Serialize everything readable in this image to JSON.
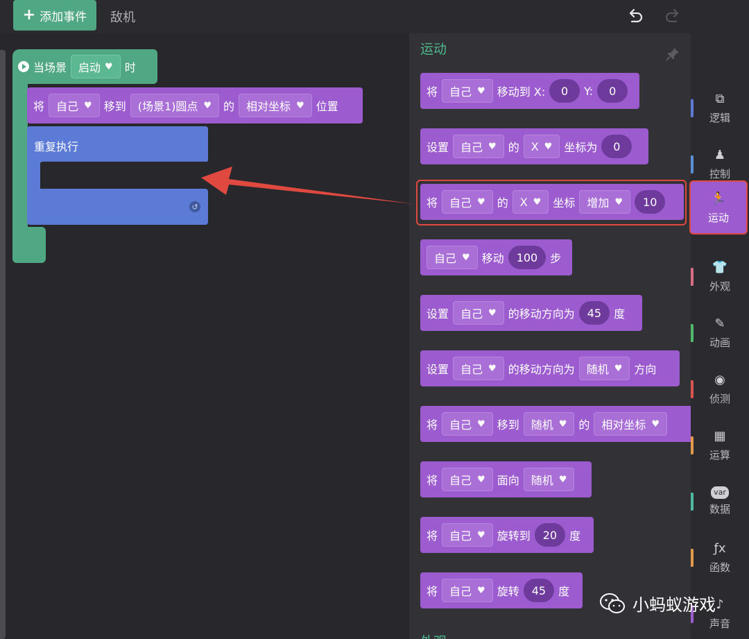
{
  "topbar": {
    "add_event_label": "添加事件",
    "current_tab": "敌机"
  },
  "workspace": {
    "hat": {
      "prefix": "当场景",
      "dropdown": "启动",
      "suffix": "时"
    },
    "move_block": {
      "verb": "将",
      "target": "自己",
      "action": "移到",
      "destination": "(场景1)圆点",
      "of": "的",
      "coord": "相对坐标",
      "suffix": "位置"
    },
    "repeat_label": "重复执行"
  },
  "palette": {
    "section_title": "运动",
    "next_section_title": "外观",
    "blocks": [
      {
        "parts": [
          {
            "t": "text",
            "v": "将"
          },
          {
            "t": "dd",
            "v": "自己"
          },
          {
            "t": "text",
            "v": "移动到 X:"
          },
          {
            "t": "pill",
            "v": "0"
          },
          {
            "t": "text",
            "v": "Y:"
          },
          {
            "t": "pill",
            "v": "0"
          }
        ]
      },
      {
        "parts": [
          {
            "t": "text",
            "v": "设置"
          },
          {
            "t": "dd",
            "v": "自己"
          },
          {
            "t": "text",
            "v": "的"
          },
          {
            "t": "dd",
            "v": "X"
          },
          {
            "t": "text",
            "v": "坐标为"
          },
          {
            "t": "pill",
            "v": "0"
          }
        ]
      },
      {
        "parts": [
          {
            "t": "text",
            "v": "将"
          },
          {
            "t": "dd",
            "v": "自己"
          },
          {
            "t": "text",
            "v": "的"
          },
          {
            "t": "dd",
            "v": "X"
          },
          {
            "t": "text",
            "v": "坐标"
          },
          {
            "t": "dd",
            "v": "增加"
          },
          {
            "t": "pill",
            "v": "10"
          }
        ]
      },
      {
        "parts": [
          {
            "t": "dd",
            "v": "自己"
          },
          {
            "t": "text",
            "v": "移动"
          },
          {
            "t": "pill",
            "v": "100"
          },
          {
            "t": "text",
            "v": "步"
          }
        ]
      },
      {
        "parts": [
          {
            "t": "text",
            "v": "设置"
          },
          {
            "t": "dd",
            "v": "自己"
          },
          {
            "t": "text",
            "v": "的移动方向为"
          },
          {
            "t": "pill",
            "v": "45"
          },
          {
            "t": "text",
            "v": "度"
          }
        ]
      },
      {
        "parts": [
          {
            "t": "text",
            "v": "设置"
          },
          {
            "t": "dd",
            "v": "自己"
          },
          {
            "t": "text",
            "v": "的移动方向为"
          },
          {
            "t": "dd",
            "v": "随机"
          },
          {
            "t": "text",
            "v": "方向"
          }
        ]
      },
      {
        "parts": [
          {
            "t": "text",
            "v": "将"
          },
          {
            "t": "dd",
            "v": "自己"
          },
          {
            "t": "text",
            "v": "移到"
          },
          {
            "t": "dd",
            "v": "随机"
          },
          {
            "t": "text",
            "v": "的"
          },
          {
            "t": "dd",
            "v": "相对坐标"
          }
        ]
      },
      {
        "parts": [
          {
            "t": "text",
            "v": "将"
          },
          {
            "t": "dd",
            "v": "自己"
          },
          {
            "t": "text",
            "v": "面向"
          },
          {
            "t": "dd",
            "v": "随机"
          }
        ]
      },
      {
        "parts": [
          {
            "t": "text",
            "v": "将"
          },
          {
            "t": "dd",
            "v": "自己"
          },
          {
            "t": "text",
            "v": "旋转到"
          },
          {
            "t": "pill",
            "v": "20"
          },
          {
            "t": "text",
            "v": "度"
          }
        ]
      },
      {
        "parts": [
          {
            "t": "text",
            "v": "将"
          },
          {
            "t": "dd",
            "v": "自己"
          },
          {
            "t": "text",
            "v": "旋转"
          },
          {
            "t": "pill",
            "v": "45"
          },
          {
            "t": "text",
            "v": "度"
          }
        ]
      }
    ]
  },
  "sidebar": {
    "categories": [
      {
        "label": "逻辑",
        "icon": "logic-icon",
        "color": "#5b7bd6"
      },
      {
        "label": "控制",
        "icon": "control-icon",
        "color": "#5b8fd6"
      },
      {
        "label": "运动",
        "icon": "runner-icon",
        "color": "#9c5ccf",
        "active": true
      },
      {
        "label": "外观",
        "icon": "shirt-icon",
        "color": "#d96b85"
      },
      {
        "label": "动画",
        "icon": "animation-icon",
        "color": "#4fb86a"
      },
      {
        "label": "侦测",
        "icon": "sensor-icon",
        "color": "#d9534f"
      },
      {
        "label": "运算",
        "icon": "calculator-icon",
        "color": "#e09a4a"
      },
      {
        "label": "数据",
        "icon": "var-icon",
        "color": "#4fb8a0"
      },
      {
        "label": "函数",
        "icon": "function-icon",
        "color": "#e09a4a"
      },
      {
        "label": "声音",
        "icon": "sound-icon",
        "color": "#9c5ccf"
      }
    ]
  },
  "watermark": {
    "text": "小蚂蚁游戏"
  },
  "colors": {
    "accent_green": "#4fa883",
    "motion_purple": "#9c5ccf",
    "highlight_red": "#e0493f",
    "repeat_blue": "#5b7bd6"
  }
}
